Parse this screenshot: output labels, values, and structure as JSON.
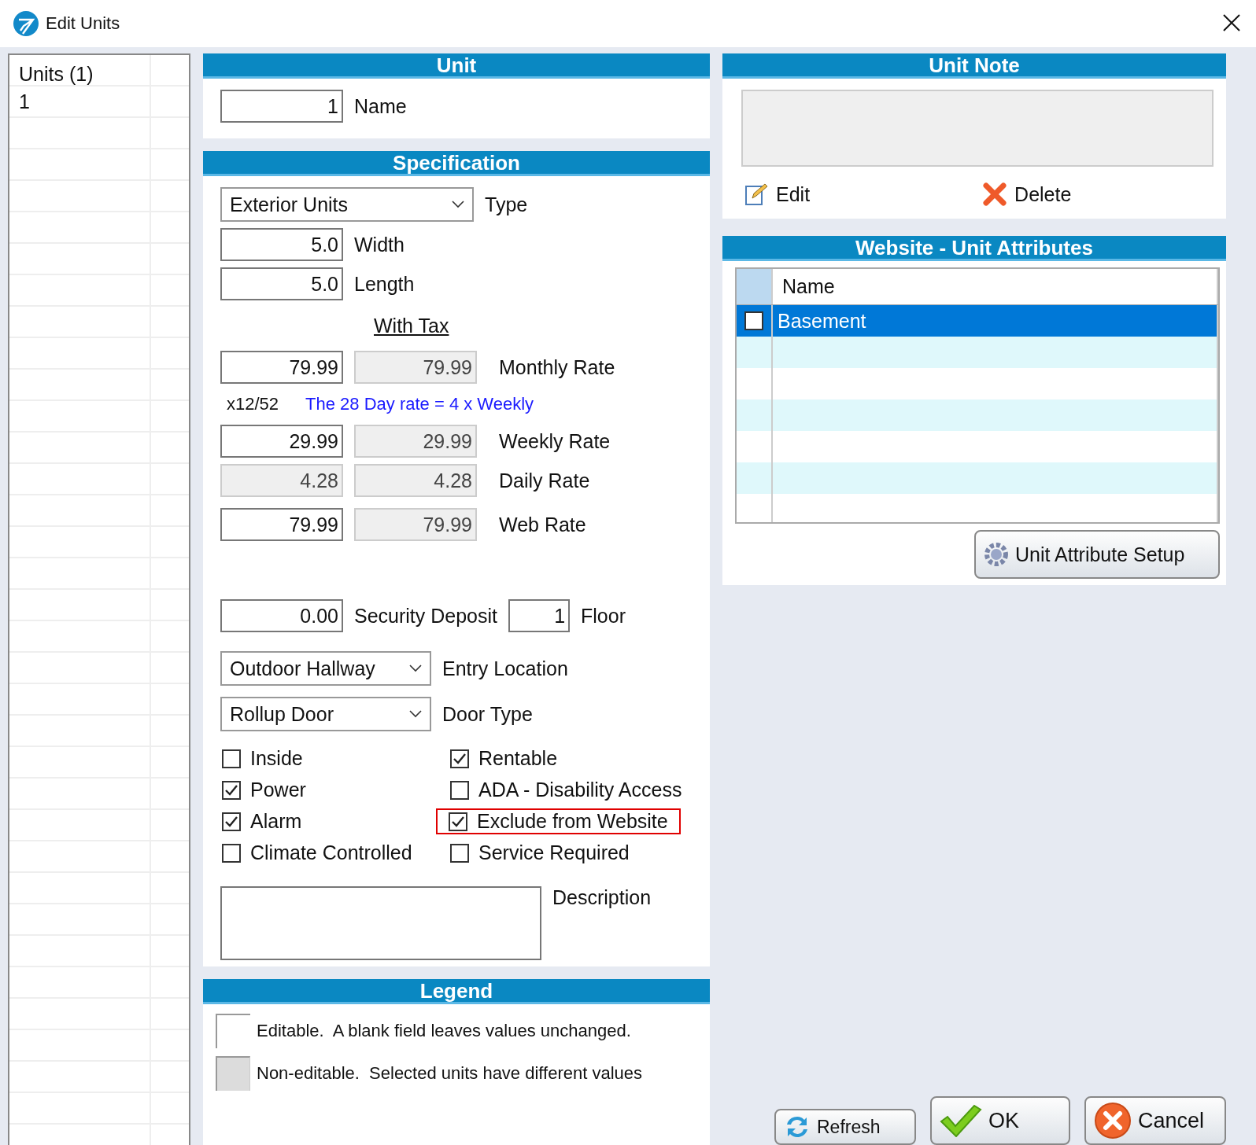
{
  "window": {
    "title": "Edit Units"
  },
  "units_list": {
    "header": "Units (1)",
    "rows": [
      {
        "label": "1",
        "selected": false
      }
    ]
  },
  "unit": {
    "title": "Unit",
    "name_value": "1",
    "name_label": "Name"
  },
  "specification": {
    "title": "Specification",
    "type": {
      "value": "Exterior Units",
      "label": "Type"
    },
    "width": {
      "value": "5.0",
      "label": "Width"
    },
    "length": {
      "value": "5.0",
      "label": "Length"
    },
    "with_tax_heading": "With Tax",
    "rates": [
      {
        "label": "Monthly Rate",
        "value": "79.99",
        "editable": true,
        "with_tax": "79.99"
      },
      {
        "note_left": "x12/52",
        "note_right": "The 28 Day rate = 4 x Weekly",
        "kind": "note"
      },
      {
        "label": "Weekly Rate",
        "value": "29.99",
        "editable": true,
        "with_tax": "29.99"
      },
      {
        "label": "Daily Rate",
        "value": "4.28",
        "editable": false,
        "with_tax": "4.28"
      },
      {
        "label": "Web Rate",
        "value": "79.99",
        "editable": true,
        "with_tax": "79.99",
        "kind": "gap"
      }
    ],
    "security_deposit": {
      "value": "0.00",
      "label": "Security Deposit"
    },
    "floor": {
      "value": "1",
      "label": "Floor"
    },
    "entry_location": {
      "value": "Outdoor Hallway",
      "label": "Entry Location"
    },
    "door_type": {
      "value": "Rollup Door",
      "label": "Door Type"
    },
    "checkboxes_left": [
      {
        "label": "Inside",
        "checked": false,
        "highlighted": false
      },
      {
        "label": "Power",
        "checked": true,
        "highlighted": false
      },
      {
        "label": "Alarm",
        "checked": true,
        "highlighted": false
      },
      {
        "label": "Climate Controlled",
        "checked": false,
        "highlighted": false
      }
    ],
    "checkboxes_right": [
      {
        "label": "Rentable",
        "checked": true,
        "highlighted": false
      },
      {
        "label": "ADA - Disability Access",
        "checked": false,
        "highlighted": false
      },
      {
        "label": "Exclude from Website",
        "checked": true,
        "highlighted": true
      },
      {
        "label": "Service Required",
        "checked": false,
        "highlighted": false
      }
    ],
    "description_label": "Description"
  },
  "legend": {
    "title": "Legend",
    "items": [
      {
        "editable": true,
        "text": "Editable.  A blank field leaves values unchanged."
      },
      {
        "editable": false,
        "text": "Non-editable.  Selected units have different values"
      }
    ]
  },
  "unit_note": {
    "title": "Unit Note",
    "edit": "Edit",
    "delete": "Delete"
  },
  "attributes": {
    "title": "Website - Unit Attributes",
    "column": "Name",
    "rows": [
      {
        "name": "Basement",
        "checked": false,
        "selected": true
      }
    ],
    "setup_button": "Unit Attribute Setup"
  },
  "buttons": [
    {
      "kind": "refresh",
      "label": "Refresh"
    },
    {
      "kind": "ok",
      "label": "OK"
    },
    {
      "kind": "cancel",
      "label": "Cancel"
    }
  ]
}
